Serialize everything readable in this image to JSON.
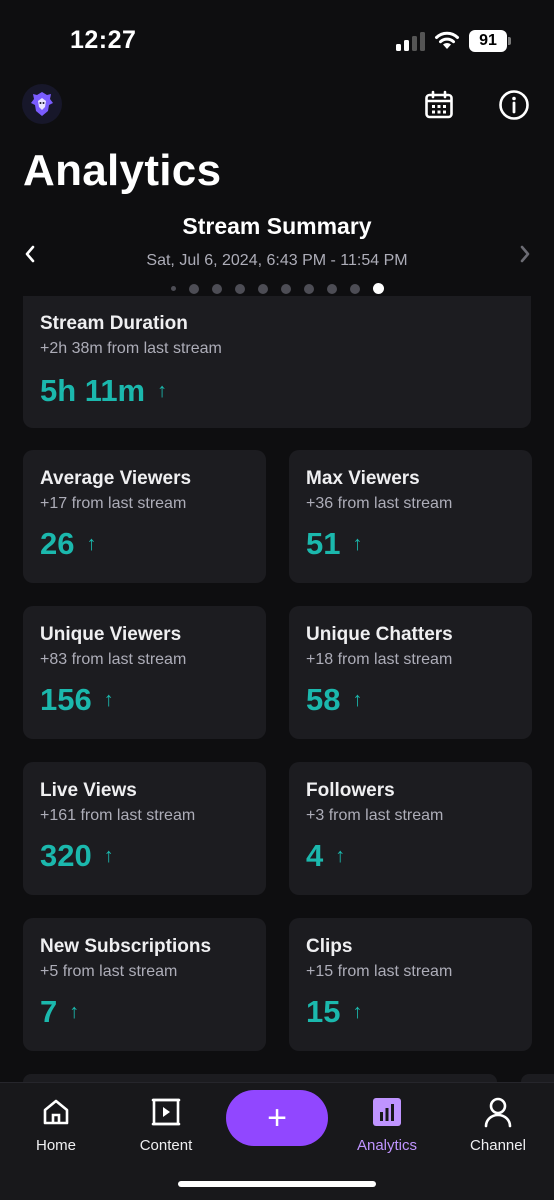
{
  "status_bar": {
    "time": "12:27",
    "battery": "91"
  },
  "header": {
    "title": "Analytics"
  },
  "summary": {
    "title": "Stream Summary",
    "date_range": "Sat, Jul 6, 2024, 6:43 PM - 11:54 PM",
    "page_count": 10,
    "active_page": 10
  },
  "stream_duration": {
    "label": "Stream Duration",
    "delta": "+2h 38m from last stream",
    "value": "5h 11m"
  },
  "stats": [
    {
      "label": "Average Viewers",
      "delta": "+17 from last stream",
      "value": "26"
    },
    {
      "label": "Max Viewers",
      "delta": "+36 from last stream",
      "value": "51"
    },
    {
      "label": "Unique Viewers",
      "delta": "+83 from last stream",
      "value": "156"
    },
    {
      "label": "Unique Chatters",
      "delta": "+18 from last stream",
      "value": "58"
    },
    {
      "label": "Live Views",
      "delta": "+161 from last stream",
      "value": "320"
    },
    {
      "label": "Followers",
      "delta": "+3 from last stream",
      "value": "4"
    },
    {
      "label": "New Subscriptions",
      "delta": "+5 from last stream",
      "value": "7"
    },
    {
      "label": "Clips",
      "delta": "+15 from last stream",
      "value": "15"
    }
  ],
  "trend_icon": "arrow-up-icon",
  "tabs": [
    {
      "label": "Home",
      "icon": "home-icon"
    },
    {
      "label": "Content",
      "icon": "content-icon"
    },
    {
      "label": "Analytics",
      "icon": "analytics-icon",
      "active": true
    },
    {
      "label": "Channel",
      "icon": "person-icon"
    }
  ],
  "create_button": {
    "label": "+"
  },
  "colors": {
    "background": "#0e0e10",
    "card": "#1c1c20",
    "accent_teal": "#1bb8ad",
    "brand_purple": "#9147ff",
    "active_tab": "#bf94ff"
  }
}
